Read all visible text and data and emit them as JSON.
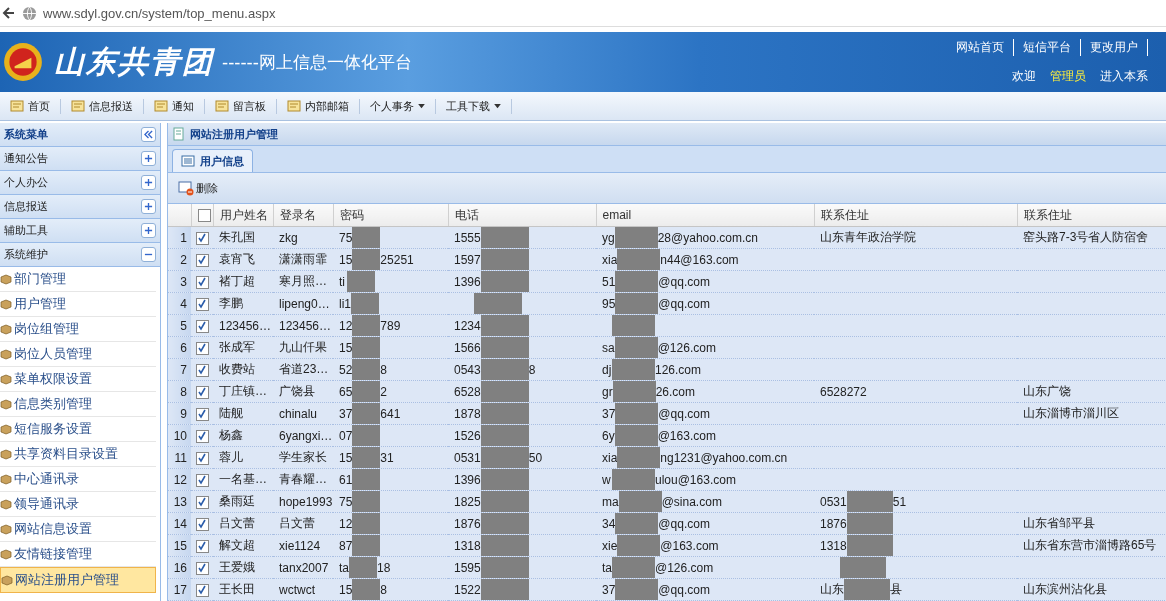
{
  "browser": {
    "url": "www.sdyl.gov.cn/system/top_menu.aspx"
  },
  "header": {
    "logo_text": "山东共青团",
    "subtitle": "------网上信息一体化平台",
    "links": [
      "网站首页",
      "短信平台",
      "更改用户"
    ],
    "welcome": "欢迎",
    "user": "管理员",
    "enter_link": "进入本系"
  },
  "toolbar": [
    {
      "label": "首页",
      "kind": "link"
    },
    {
      "label": "信息报送",
      "kind": "link"
    },
    {
      "label": "通知",
      "kind": "link"
    },
    {
      "label": "留言板",
      "kind": "link"
    },
    {
      "label": "内部邮箱",
      "kind": "link"
    },
    {
      "label": "个人事务",
      "kind": "dropdown"
    },
    {
      "label": "工具下载",
      "kind": "dropdown"
    }
  ],
  "sidebar": {
    "title": "系统菜单",
    "sections": [
      {
        "label": "通知公告",
        "expanded": false
      },
      {
        "label": "个人办公",
        "expanded": false
      },
      {
        "label": "信息报送",
        "expanded": false
      },
      {
        "label": "辅助工具",
        "expanded": false
      },
      {
        "label": "系统维护",
        "expanded": true,
        "children": [
          {
            "label": "部门管理",
            "selected": false
          },
          {
            "label": "用户管理",
            "selected": false
          },
          {
            "label": "岗位组管理",
            "selected": false
          },
          {
            "label": "岗位人员管理",
            "selected": false
          },
          {
            "label": "菜单权限设置",
            "selected": false
          },
          {
            "label": "信息类别管理",
            "selected": false
          },
          {
            "label": "短信服务设置",
            "selected": false
          },
          {
            "label": "共享资料目录设置",
            "selected": false
          },
          {
            "label": "中心通讯录",
            "selected": false
          },
          {
            "label": "领导通讯录",
            "selected": false
          },
          {
            "label": "网站信息设置",
            "selected": false
          },
          {
            "label": "友情链接管理",
            "selected": false
          },
          {
            "label": "网站注册用户管理",
            "selected": true
          }
        ]
      }
    ]
  },
  "panel": {
    "title": "网站注册用户管理",
    "tabs": [
      {
        "label": "用户信息",
        "selected": true
      }
    ],
    "actions": [
      "删除"
    ]
  },
  "table": {
    "columns": [
      "用户姓名",
      "登录名",
      "密码",
      "电话",
      "email",
      "联系住址",
      "联系住址"
    ],
    "select_all_checked": false,
    "rows": [
      {
        "index": "1",
        "checked": true,
        "cells": [
          "朱孔国",
          "zkg",
          {
            "redacted": true,
            "head": "75"
          },
          {
            "redacted": true,
            "head": "1555"
          },
          {
            "redacted": true,
            "head": "yg",
            "tail": "28@yahoo.com.cn"
          },
          "山东青年政治学院",
          "窑头路7-3号省人防宿舍"
        ]
      },
      {
        "index": "2",
        "checked": true,
        "cells": [
          "袁宵飞",
          "潇潇雨霏",
          {
            "redacted": true,
            "head": "15",
            "tail": "25251"
          },
          {
            "redacted": true,
            "head": "1597"
          },
          {
            "redacted": true,
            "head": "xia",
            "tail": "n44@163.com"
          },
          null,
          null
        ]
      },
      {
        "index": "3",
        "checked": true,
        "cells": [
          "褚丁超",
          "寒月照…",
          {
            "redacted": true,
            "head": "ti"
          },
          {
            "redacted": true,
            "head": "1396"
          },
          {
            "redacted": true,
            "head": "51",
            "tail": "@qq.com"
          },
          null,
          null
        ]
      },
      {
        "index": "4",
        "checked": true,
        "cells": [
          "李鹏",
          "lipeng0…",
          {
            "redacted": true,
            "head": "li1"
          },
          {
            "redacted": true
          },
          {
            "redacted": true,
            "head": "95",
            "tail": "@qq.com"
          },
          null,
          null
        ]
      },
      {
        "index": "5",
        "checked": true,
        "cells": [
          "123456…",
          "123456…",
          {
            "redacted": true,
            "head": "12",
            "tail": "789"
          },
          {
            "redacted": true,
            "head": "1234"
          },
          {
            "redacted": true
          },
          null,
          null
        ]
      },
      {
        "index": "6",
        "checked": true,
        "cells": [
          "张成军",
          "九山仟果",
          {
            "redacted": true,
            "head": "15"
          },
          {
            "redacted": true,
            "head": "1566"
          },
          {
            "redacted": true,
            "head": "sa",
            "tail": "@126.com"
          },
          null,
          null
        ]
      },
      {
        "index": "7",
        "checked": true,
        "cells": [
          "收费站",
          "省道23…",
          {
            "redacted": true,
            "head": "52",
            "tail": "8"
          },
          {
            "redacted": true,
            "head": "0543",
            "tail": "8"
          },
          {
            "redacted": true,
            "head": "dj",
            "tail": "126.com"
          },
          null,
          null
        ]
      },
      {
        "index": "8",
        "checked": true,
        "cells": [
          "丁庄镇…",
          "广饶县",
          {
            "redacted": true,
            "head": "65",
            "tail": "2"
          },
          {
            "redacted": true,
            "head": "6528"
          },
          {
            "redacted": true,
            "head": "gr",
            "tail": "26.com"
          },
          "6528272",
          "山东广饶"
        ]
      },
      {
        "index": "9",
        "checked": true,
        "cells": [
          "陆舰",
          "chinalu",
          {
            "redacted": true,
            "head": "37",
            "tail": "641"
          },
          {
            "redacted": true,
            "head": "1878"
          },
          {
            "redacted": true,
            "head": "37",
            "tail": "@qq.com"
          },
          null,
          "山东淄博市淄川区"
        ]
      },
      {
        "index": "10",
        "checked": true,
        "cells": [
          "杨鑫",
          "6yangxi…",
          {
            "redacted": true,
            "head": "07"
          },
          {
            "redacted": true,
            "head": "1526"
          },
          {
            "redacted": true,
            "head": "6y",
            "tail": "@163.com"
          },
          null,
          null
        ]
      },
      {
        "index": "11",
        "checked": true,
        "cells": [
          "蓉儿",
          "学生家长",
          {
            "redacted": true,
            "head": "15",
            "tail": "31"
          },
          {
            "redacted": true,
            "head": "0531",
            "tail": "50"
          },
          {
            "redacted": true,
            "head": "xia",
            "tail": "ng1231@yahoo.com.cn"
          },
          null,
          null
        ]
      },
      {
        "index": "12",
        "checked": true,
        "cells": [
          "一名基…",
          "青春耀…",
          {
            "redacted": true,
            "head": "61"
          },
          {
            "redacted": true,
            "head": "1396"
          },
          {
            "redacted": true,
            "head": "w",
            "tail": "ulou@163.com"
          },
          null,
          null
        ]
      },
      {
        "index": "13",
        "checked": true,
        "cells": [
          "桑雨廷",
          "hope1993",
          {
            "redacted": true,
            "head": "75"
          },
          {
            "redacted": true,
            "head": "1825"
          },
          {
            "redacted": true,
            "head": "ma",
            "tail": "@sina.com"
          },
          {
            "redacted": true,
            "head": "0531",
            "tail": "51"
          },
          null
        ]
      },
      {
        "index": "14",
        "checked": true,
        "cells": [
          "吕文蕾",
          "吕文蕾",
          {
            "redacted": true,
            "head": "12"
          },
          {
            "redacted": true,
            "head": "1876"
          },
          {
            "redacted": true,
            "head": "34",
            "tail": "@qq.com"
          },
          {
            "redacted": true,
            "head": "1876"
          },
          "山东省邹平县"
        ]
      },
      {
        "index": "15",
        "checked": true,
        "cells": [
          "解文超",
          "xie1124",
          {
            "redacted": true,
            "head": "87"
          },
          {
            "redacted": true,
            "head": "1318"
          },
          {
            "redacted": true,
            "head": "xie",
            "tail": "@163.com"
          },
          {
            "redacted": true,
            "head": "1318"
          },
          "山东省东营市淄博路65号"
        ]
      },
      {
        "index": "16",
        "checked": true,
        "cells": [
          "王爱娥",
          "tanx2007",
          {
            "redacted": true,
            "head": "ta",
            "tail": "18"
          },
          {
            "redacted": true,
            "head": "1595"
          },
          {
            "redacted": true,
            "head": "ta",
            "tail": "@126.com"
          },
          {
            "redacted": true
          },
          null
        ]
      },
      {
        "index": "17",
        "checked": true,
        "cells": [
          "王长田",
          "wctwct",
          {
            "redacted": true,
            "head": "15",
            "tail": "8"
          },
          {
            "redacted": true,
            "head": "1522"
          },
          {
            "redacted": true,
            "head": "37",
            "tail": "@qq.com"
          },
          {
            "redacted": true,
            "head": "山东",
            "tail": "县"
          },
          "山东滨州沾化县"
        ]
      }
    ]
  }
}
